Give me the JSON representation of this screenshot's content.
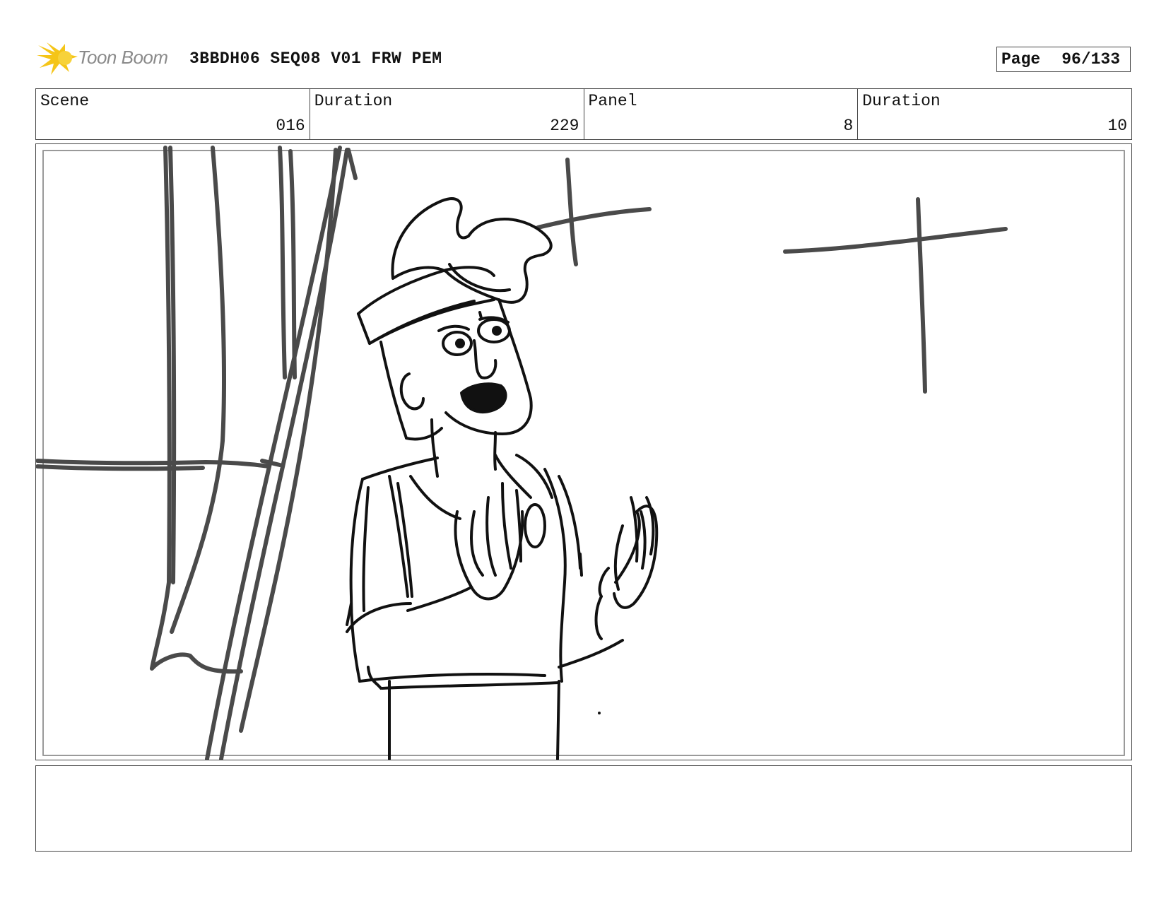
{
  "header": {
    "logo_text": "Toon Boom",
    "title": "3BBDH06 SEQ08 V01 FRW PEM",
    "page_label": "Page",
    "page_value": "96/133"
  },
  "info": {
    "scene_label": "Scene",
    "scene_value": "016",
    "scene_duration_label": "Duration",
    "scene_duration_value": "229",
    "panel_label": "Panel",
    "panel_value": "8",
    "panel_duration_label": "Duration",
    "panel_duration_value": "10"
  },
  "notes": {
    "text": ""
  },
  "colors": {
    "logo_yellow": "#f5c518",
    "logo_gray": "#8a8a8a",
    "sketch_gray": "#4a4a4a",
    "sketch_black": "#111111"
  }
}
